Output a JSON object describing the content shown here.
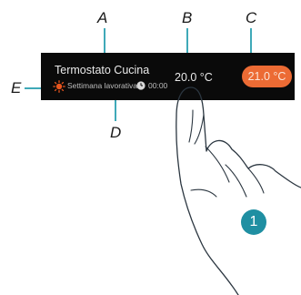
{
  "callouts": {
    "a": "A",
    "b": "B",
    "c": "C",
    "d": "D",
    "e": "E"
  },
  "panel": {
    "room_name": "Termostato Cucina",
    "program_name": "Settimana lavorativa",
    "program_time": "00:00",
    "measured_temperature": "20.0 °C",
    "setpoint_temperature": "21.0 °C",
    "icons": {
      "mode": "sun-icon",
      "time": "clock-icon"
    },
    "colors": {
      "panel_background": "#0a0a0a",
      "setpoint_accent": "#ec6b34",
      "mode_icon": "#e8551e",
      "callout_line": "#3fa9b8"
    }
  },
  "step": {
    "number": "1",
    "color": "#1f8fa2"
  }
}
